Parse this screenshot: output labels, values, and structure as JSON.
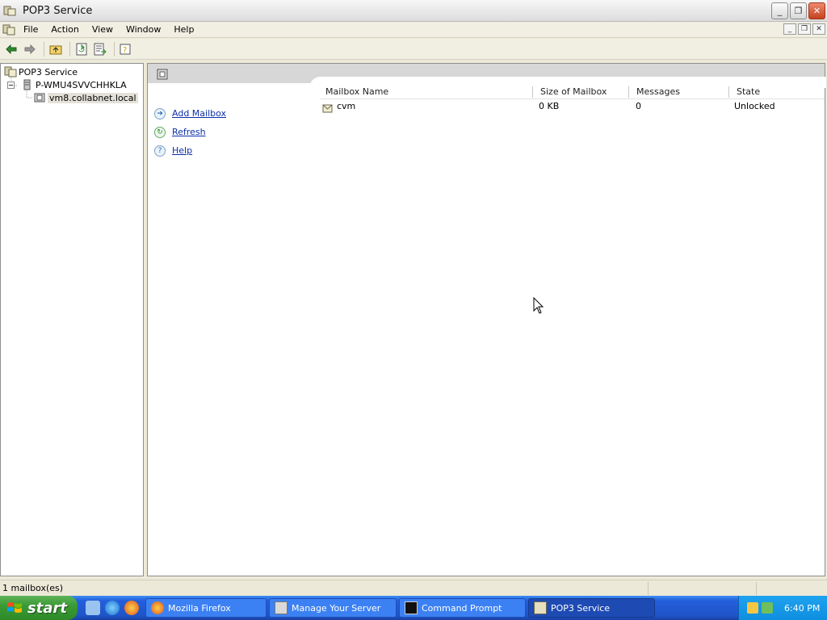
{
  "window": {
    "title": "POP3 Service",
    "controls": {
      "minimize": "_",
      "restore": "❐",
      "close": "✕"
    }
  },
  "menu": {
    "items": [
      "File",
      "Action",
      "View",
      "Window",
      "Help"
    ]
  },
  "tree": {
    "root": "POP3 Service",
    "server": "P-WMU4SVVCHHKLA",
    "domain": "vm8.collabnet.local"
  },
  "tasks": [
    {
      "label": "Add Mailbox",
      "icon": "add-icon"
    },
    {
      "label": "Refresh",
      "icon": "refresh-icon"
    },
    {
      "label": "Help",
      "icon": "help-icon"
    }
  ],
  "mailboxes": {
    "columns": [
      "Mailbox Name",
      "Size of Mailbox",
      "Messages",
      "State"
    ],
    "rows": [
      {
        "name": "cvm",
        "size": "0 KB",
        "messages": "0",
        "state": "Unlocked"
      }
    ]
  },
  "status": {
    "text": "1 mailbox(es)"
  },
  "taskbar": {
    "start_label": "start",
    "buttons": [
      {
        "label": "Mozilla Firefox",
        "icon": "firefox-icon"
      },
      {
        "label": "Manage Your Server",
        "icon": "server-icon"
      },
      {
        "label": "Command Prompt",
        "icon": "cmd-icon"
      },
      {
        "label": "POP3 Service",
        "icon": "pop3-icon",
        "active": true
      }
    ],
    "clock": "6:40 PM"
  }
}
